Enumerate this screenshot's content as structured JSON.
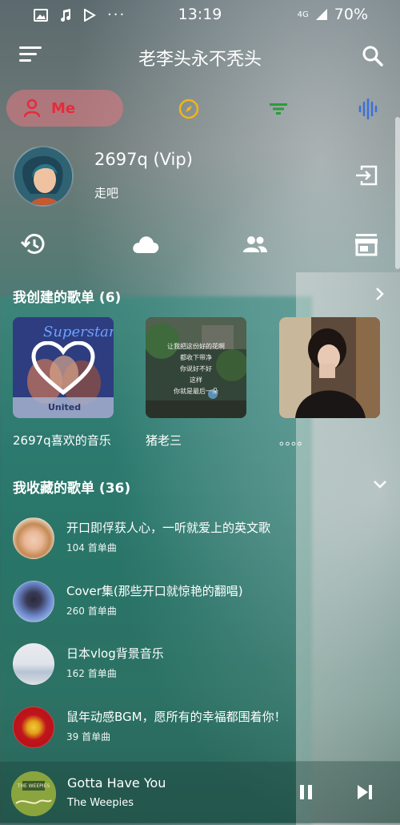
{
  "status": {
    "time": "13:19",
    "battery": "70%",
    "network": "4G"
  },
  "header": {
    "title": "老李头永不秃头"
  },
  "tabs": {
    "me_label": "Me"
  },
  "profile": {
    "username": "2697q (Vip)",
    "signature": "走吧"
  },
  "created": {
    "title": "我创建的歌单 (6)",
    "playlists": [
      {
        "label": "2697q喜欢的音乐"
      },
      {
        "label": "猪老三"
      },
      {
        "label": "。。。。"
      }
    ],
    "cover2_lines": [
      "让我把这份好的花啊",
      "都收下带净",
      "你说好不好",
      "这样",
      "你就是最后一朵"
    ]
  },
  "collected": {
    "title": "我收藏的歌单 (36)",
    "items": [
      {
        "name": "开口即俘获人心，一听就爱上的英文歌",
        "count": "104 首单曲"
      },
      {
        "name": "Cover集(那些开口就惊艳的翻唱)",
        "count": "260 首单曲"
      },
      {
        "name": "日本vlog背景音乐",
        "count": "162 首单曲"
      },
      {
        "name": "鼠年动感BGM，愿所有的幸福都围着你！",
        "count": "39 首单曲"
      }
    ]
  },
  "player": {
    "title": "Gotta Have You",
    "artist": "The Weepies",
    "thumb_text": "THE WEEPIES"
  },
  "colors": {
    "accent": "#e52b3c",
    "discover": "#f0b515",
    "filter": "#2e9a3c",
    "audio": "#3e6fd8"
  }
}
